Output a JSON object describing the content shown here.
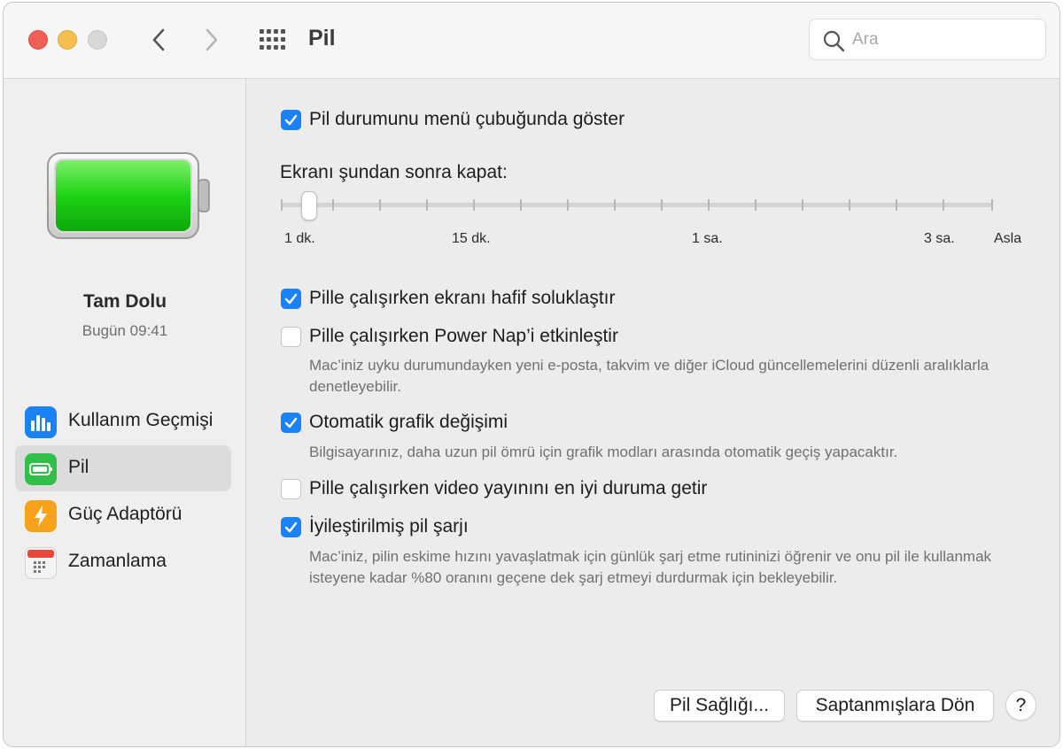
{
  "window": {
    "title": "Pil"
  },
  "search": {
    "placeholder": "Ara",
    "value": ""
  },
  "battery_status": {
    "title": "Tam Dolu",
    "time": "Bugün 09:41",
    "level_fraction": 1.0,
    "fill_color": "#2fd12b"
  },
  "sidebar": {
    "items": [
      {
        "label": "Kullanım Geçmişi",
        "icon": "usage-history-icon",
        "color": "#1a82f6",
        "active": false
      },
      {
        "label": "Pil",
        "icon": "battery-icon",
        "color": "#30c04a",
        "active": true
      },
      {
        "label": "Güç Adaptörü",
        "icon": "power-adapter-icon",
        "color": "#f7a21b",
        "active": false
      },
      {
        "label": "Zamanlama",
        "icon": "calendar-icon",
        "color": "#e8473b",
        "active": false
      }
    ]
  },
  "main": {
    "show_status": {
      "label": "Pil durumunu menü çubuğunda göster",
      "checked": true
    },
    "slider": {
      "label": "Ekranı şundan sonra kapat:",
      "tick_labels": [
        "1 dk.",
        "15 dk.",
        "1 sa.",
        "3 sa.",
        "Asla"
      ],
      "selected": "1 dk."
    },
    "options": [
      {
        "label": "Pille çalışırken ekranı hafif soluklaştır",
        "checked": true,
        "desc": ""
      },
      {
        "label": "Pille çalışırken Power Nap’i etkinleştir",
        "checked": false,
        "desc": "Mac’iniz uyku durumundayken yeni e-posta, takvim ve diğer iCloud güncellemelerini düzenli aralıklarla denetleyebilir."
      },
      {
        "label": "Otomatik grafik değişimi",
        "checked": true,
        "desc": "Bilgisayarınız, daha uzun pil ömrü için grafik modları arasında otomatik geçiş yapacaktır."
      },
      {
        "label": "Pille çalışırken video yayınını en iyi duruma getir",
        "checked": false,
        "desc": ""
      },
      {
        "label": "İyileştirilmiş pil şarjı",
        "checked": true,
        "desc": "Mac’iniz, pilin eskime hızını yavaşlatmak için günlük şarj etme rutininizi öğrenir ve onu pil ile kullanmak isteyene kadar %80 oranını geçene dek şarj etmeyi durdurmak için bekleyebilir."
      }
    ],
    "buttons": {
      "battery_health": "Pil Sağlığı...",
      "restore_defaults": "Saptanmışlara Dön",
      "help": "?"
    }
  },
  "colors": {
    "accent": "#1b82f6",
    "close": "#ee5f57",
    "minimize": "#f5be4f",
    "maximize": "#d8d8d8"
  }
}
